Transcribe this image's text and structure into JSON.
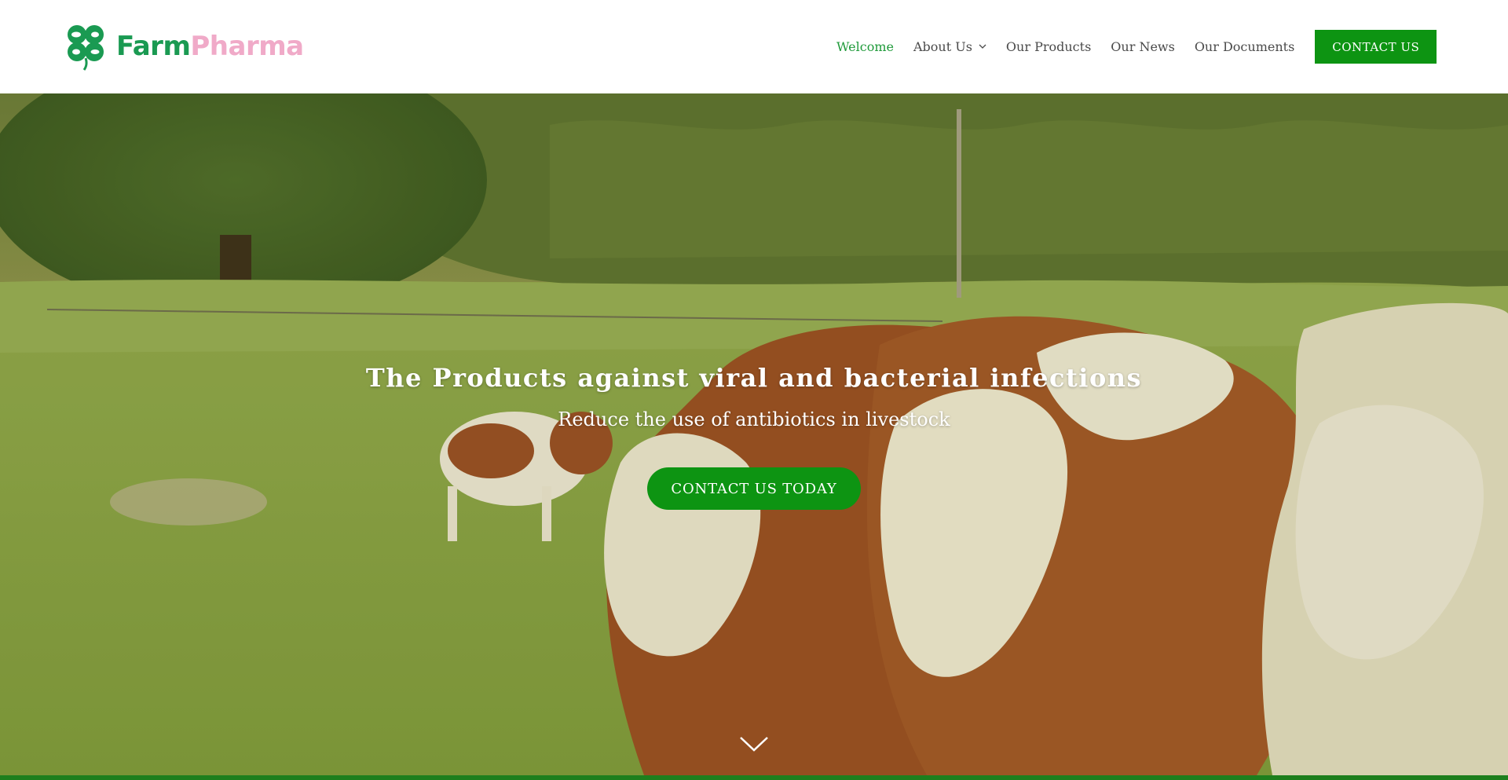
{
  "brand": {
    "name_part1": "Farm",
    "name_part2": "Pharma",
    "color_primary": "#1a9a52",
    "color_secondary": "#f0aac8"
  },
  "nav": {
    "items": [
      {
        "label": "Welcome",
        "active": true
      },
      {
        "label": "About Us",
        "has_dropdown": true
      },
      {
        "label": "Our Products"
      },
      {
        "label": "Our News"
      },
      {
        "label": "Our Documents"
      }
    ],
    "cta_label": "CONTACT US"
  },
  "hero": {
    "title": "The Products against viral and bacterial infections",
    "subtitle": "Reduce the use of antibiotics in livestock",
    "cta_label": "CONTACT US TODAY",
    "scroll_icon": "chevron-down-icon"
  },
  "colors": {
    "accent": "#0d9412",
    "active_nav": "#1f9a3a"
  }
}
